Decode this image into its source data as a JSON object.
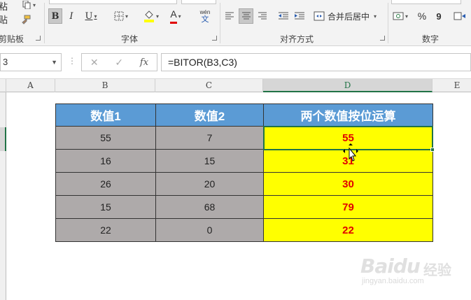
{
  "ribbon": {
    "clipboard": {
      "paste_label": "粘贴",
      "group_label": "剪贴板"
    },
    "font": {
      "bold_label": "B",
      "italic_label": "I",
      "underline_label": "U",
      "pinyin_label": "wén",
      "group_label": "字体",
      "fill_color": "#ffff00",
      "font_color": "#e00000"
    },
    "alignment": {
      "merge_label": "合并后居中",
      "group_label": "对齐方式"
    },
    "number": {
      "percent_label": "%",
      "comma_label": "9",
      "group_label": "数字"
    }
  },
  "formula_bar": {
    "name_box": "3",
    "fx_label": "fx",
    "formula": "=BITOR(B3,C3)"
  },
  "columns": [
    "A",
    "B",
    "C",
    "D",
    "E"
  ],
  "active_column": "D",
  "table": {
    "headers": [
      "数值1",
      "数值2",
      "两个数值按位运算"
    ],
    "rows": [
      [
        "55",
        "7",
        "55"
      ],
      [
        "16",
        "15",
        "31"
      ],
      [
        "26",
        "20",
        "30"
      ],
      [
        "15",
        "68",
        "79"
      ],
      [
        "22",
        "0",
        "22"
      ]
    ],
    "header_color": "#5b9bd5",
    "input_fill": "#aeaaaa",
    "result_fill": "#ffff00",
    "result_text": "#e00000"
  },
  "watermark": {
    "brand": "Baidu",
    "sub": "经验",
    "url": "jingyan.baidu.com"
  }
}
